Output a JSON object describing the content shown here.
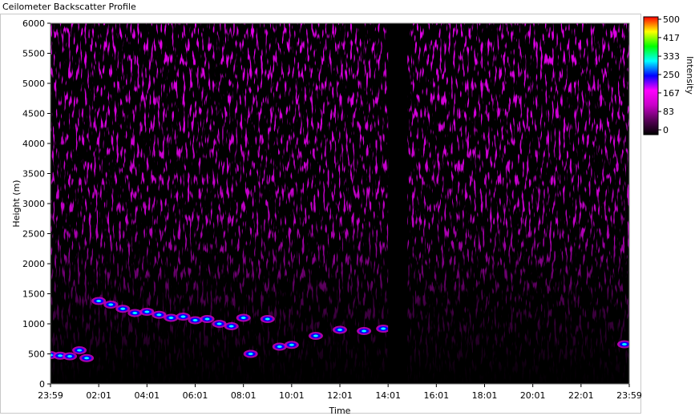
{
  "window": {
    "title": "Ceilometer Backscatter Profile"
  },
  "chart_data": {
    "type": "heatmap",
    "title": "Ceilometer Backscatter Profile",
    "xlabel": "Time",
    "ylabel": "Height (m)",
    "x_ticks": [
      "23:59",
      "02:01",
      "04:01",
      "06:01",
      "08:01",
      "10:01",
      "12:01",
      "14:01",
      "16:01",
      "18:01",
      "20:01",
      "22:01",
      "23:59"
    ],
    "x_range_hours": [
      0,
      24
    ],
    "y_ticks": [
      0,
      500,
      1000,
      1500,
      2000,
      2500,
      3000,
      3500,
      4000,
      4500,
      5000,
      5500,
      6000
    ],
    "ylim": [
      0,
      6000
    ],
    "colorbar": {
      "label": "Intensity",
      "ticks": [
        500,
        417,
        333,
        250,
        167,
        83,
        0
      ],
      "range": [
        0,
        500
      ],
      "colors": [
        "#000000",
        "#5a005a",
        "#c800c8",
        "#ff00ff",
        "#0000ff",
        "#00ffff",
        "#00ff00",
        "#ffff00",
        "#ff0000"
      ]
    },
    "data_gap_hours": [
      14.0,
      14.8
    ],
    "cloud_layer": [
      {
        "t": 0.0,
        "h": 480
      },
      {
        "t": 0.4,
        "h": 470
      },
      {
        "t": 0.8,
        "h": 460
      },
      {
        "t": 1.2,
        "h": 560
      },
      {
        "t": 1.5,
        "h": 430
      },
      {
        "t": 2.0,
        "h": 1380
      },
      {
        "t": 2.5,
        "h": 1320
      },
      {
        "t": 3.0,
        "h": 1250
      },
      {
        "t": 3.5,
        "h": 1180
      },
      {
        "t": 4.0,
        "h": 1200
      },
      {
        "t": 4.5,
        "h": 1150
      },
      {
        "t": 5.0,
        "h": 1100
      },
      {
        "t": 5.5,
        "h": 1120
      },
      {
        "t": 6.0,
        "h": 1060
      },
      {
        "t": 6.5,
        "h": 1080
      },
      {
        "t": 7.0,
        "h": 1000
      },
      {
        "t": 7.5,
        "h": 960
      },
      {
        "t": 8.0,
        "h": 1100
      },
      {
        "t": 8.3,
        "h": 500
      },
      {
        "t": 9.0,
        "h": 1080
      },
      {
        "t": 9.5,
        "h": 620
      },
      {
        "t": 10.0,
        "h": 650
      },
      {
        "t": 11.0,
        "h": 800
      },
      {
        "t": 12.0,
        "h": 900
      },
      {
        "t": 13.0,
        "h": 880
      },
      {
        "t": 13.8,
        "h": 920
      },
      {
        "t": 23.8,
        "h": 660
      }
    ]
  }
}
